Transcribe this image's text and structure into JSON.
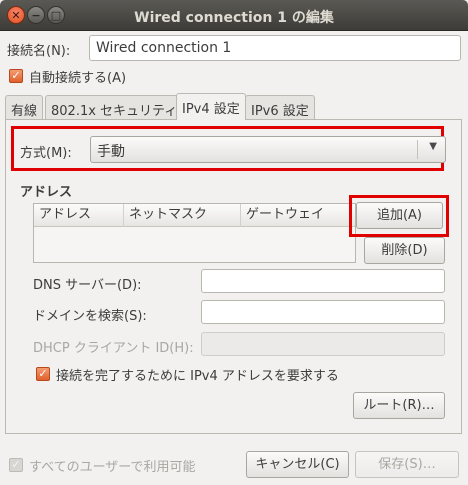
{
  "window": {
    "title": "Wired connection 1 の編集",
    "close": "✕",
    "minimize": "−",
    "maximize": "□"
  },
  "connection_name": {
    "label": "接続名(N):",
    "value": "Wired connection 1"
  },
  "auto_connect": {
    "label": "自動接続する(A)",
    "checked": true
  },
  "tabs": [
    {
      "label": "有線",
      "active": false
    },
    {
      "label": "802.1x セキュリティ",
      "active": false
    },
    {
      "label": "IPv4 設定",
      "active": true
    },
    {
      "label": "IPv6 設定",
      "active": false
    }
  ],
  "method": {
    "label": "方式(M):",
    "value": "手動"
  },
  "addresses": {
    "section_title": "アドレス",
    "columns": [
      "アドレス",
      "ネットマスク",
      "ゲートウェイ"
    ],
    "rows": [],
    "add_button": "追加(A)",
    "delete_button": "削除(D)"
  },
  "dns": {
    "label": "DNS サーバー(D):",
    "value": ""
  },
  "search_domains": {
    "label": "ドメインを検索(S):",
    "value": ""
  },
  "dhcp_client_id": {
    "label": "DHCP クライアント ID(H):",
    "value": "",
    "enabled": false
  },
  "require_ipv4": {
    "label": "接続を完了するために IPv4 アドレスを要求する",
    "checked": true
  },
  "routes_button": "ルート(R)…",
  "all_users": {
    "label": "すべてのユーザーで利用可能",
    "checked": true,
    "enabled": false
  },
  "footer": {
    "cancel": "キャンセル(C)",
    "save": "保存(S)…"
  },
  "colors": {
    "accent": "#e0612c",
    "highlight_box": "#e00000",
    "titlebar": "#3d3c38"
  },
  "icons": {
    "checkmark": "check-icon",
    "dropdown": "triangle-down-icon"
  }
}
